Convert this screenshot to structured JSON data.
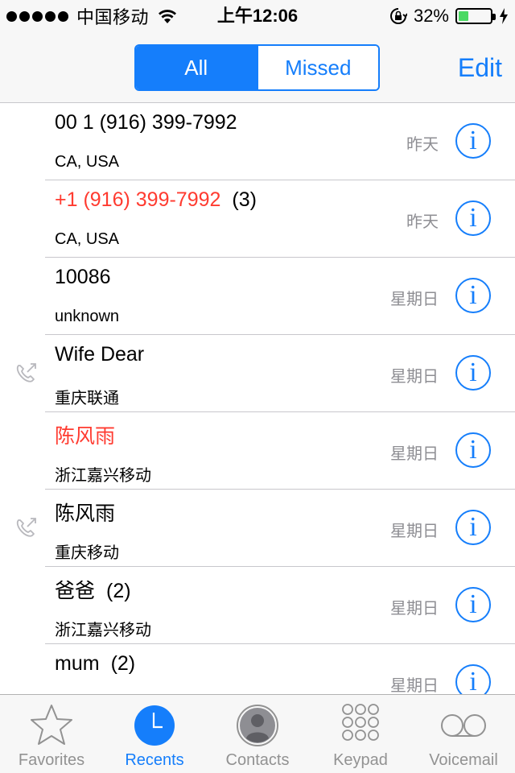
{
  "status_bar": {
    "carrier": "中国移动",
    "time": "上午12:06",
    "battery_percent": "32%",
    "battery_level": 0.32,
    "icons": [
      "signal-dots",
      "wifi-icon",
      "rotation-lock-icon",
      "battery-icon",
      "charging-bolt-icon"
    ]
  },
  "nav": {
    "segments": [
      {
        "label": "All",
        "active": true
      },
      {
        "label": "Missed",
        "active": false
      }
    ],
    "edit_label": "Edit"
  },
  "calls": [
    {
      "name": "00 1 (916) 399-7992",
      "count": "",
      "subtitle": "CA, USA",
      "date": "昨天",
      "missed": false,
      "outgoing": false
    },
    {
      "name": "+1 (916) 399-7992",
      "count": "(3)",
      "subtitle": "CA, USA",
      "date": "昨天",
      "missed": true,
      "outgoing": false
    },
    {
      "name": "10086",
      "count": "",
      "subtitle": "unknown",
      "date": "星期日",
      "missed": false,
      "outgoing": false
    },
    {
      "name": "Wife Dear",
      "count": "",
      "subtitle": "重庆联通",
      "date": "星期日",
      "missed": false,
      "outgoing": true
    },
    {
      "name": "陈风雨",
      "count": "",
      "subtitle": "浙江嘉兴移动",
      "date": "星期日",
      "missed": true,
      "outgoing": false
    },
    {
      "name": "陈风雨",
      "count": "",
      "subtitle": "重庆移动",
      "date": "星期日",
      "missed": false,
      "outgoing": true
    },
    {
      "name": "爸爸",
      "count": "(2)",
      "subtitle": "浙江嘉兴移动",
      "date": "星期日",
      "missed": false,
      "outgoing": false
    },
    {
      "name": "mum",
      "count": "(2)",
      "subtitle": "",
      "date": "星期日",
      "missed": false,
      "outgoing": false
    }
  ],
  "info_glyph": "i",
  "tabs": [
    {
      "label": "Favorites",
      "icon": "star-icon",
      "active": false
    },
    {
      "label": "Recents",
      "icon": "clock-icon",
      "active": true
    },
    {
      "label": "Contacts",
      "icon": "contact-icon",
      "active": false
    },
    {
      "label": "Keypad",
      "icon": "keypad-icon",
      "active": false
    },
    {
      "label": "Voicemail",
      "icon": "voicemail-icon",
      "active": false
    }
  ],
  "colors": {
    "accent": "#157efb",
    "missed": "#ff3b30",
    "secondary_text": "#8e8e93",
    "battery": "#4cd964"
  }
}
